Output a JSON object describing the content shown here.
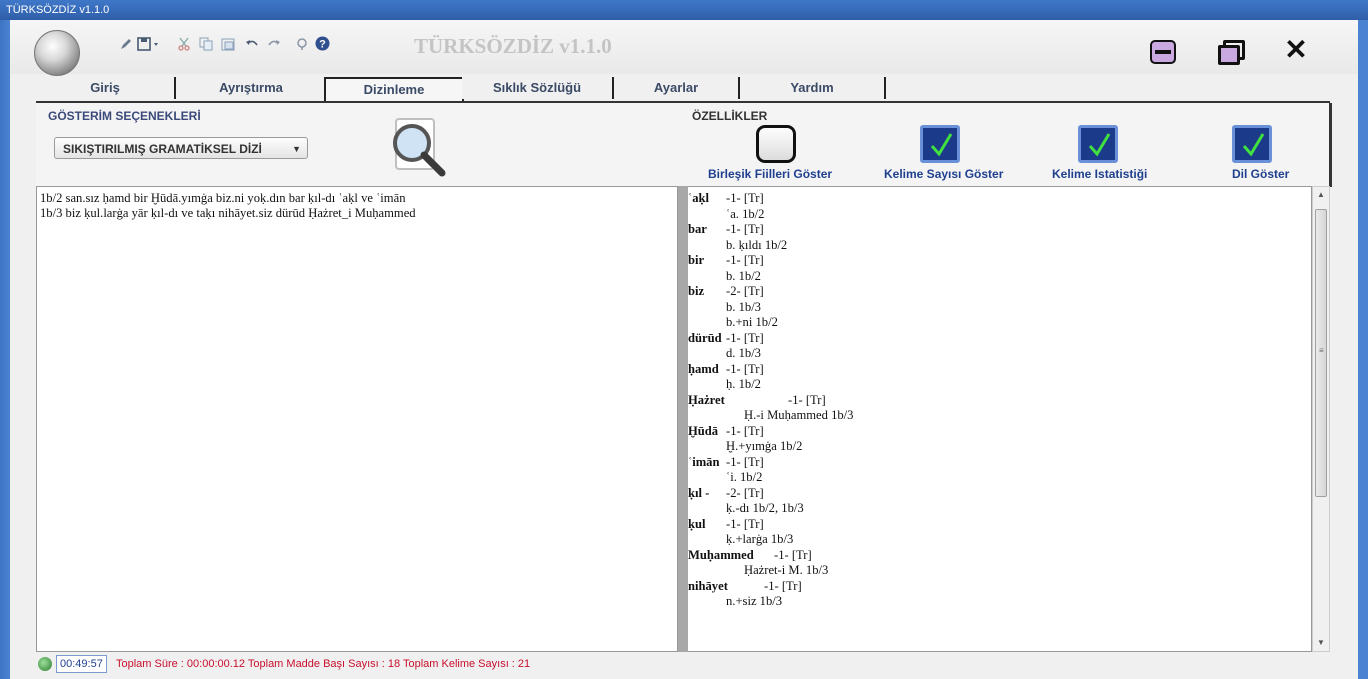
{
  "window": {
    "title": "TÜRKSÖZDİZ v1.1.0",
    "app_title": "TÜRKSÖZDİZ v1.1.0"
  },
  "toolbar_icons": [
    "edit-icon",
    "save-icon",
    "cut-icon",
    "copy-icon",
    "paste-icon",
    "undo-icon",
    "redo-icon",
    "pin-icon",
    "help-icon"
  ],
  "tabs": [
    {
      "label": "Giriş"
    },
    {
      "label": "Ayrıştırma"
    },
    {
      "label": "Dizinleme"
    },
    {
      "label": "Sıklık Sözlüğü"
    },
    {
      "label": "Ayarlar"
    },
    {
      "label": "Yardım"
    }
  ],
  "active_tab": "Dizinleme",
  "options": {
    "display_group_label": "GÖSTERİM SEÇENEKLERİ",
    "display_mode_value": "SIKIŞTIRILMIŞ GRAMATİKSEL DİZİ",
    "features_group_label": "ÖZELLİKLER",
    "checkboxes": [
      {
        "label": "Birleşik Fiilleri Göster",
        "checked": false
      },
      {
        "label": "Kelime Sayısı Göster",
        "checked": true
      },
      {
        "label": "Kelime Istatistiği",
        "checked": true
      },
      {
        "label": "Dil Göster",
        "checked": true
      }
    ]
  },
  "input_text": [
    "1b/2 san.sız ḥamd bir Ḫūdā.yımġa biz.ni yoḳ.dın bar ḳıl-dı ʿaḳl ve ʿimān",
    "1b/3 biz ḳul.larġa yār ḳıl-dı ve taḳı nihāyet.siz dürūd Ḥażret_i Muḥammed"
  ],
  "index_entries": [
    {
      "headword": "ʿaḳl",
      "count": "-1- [Tr]",
      "refs": [
        "ʿa. 1b/2"
      ]
    },
    {
      "headword": "bar",
      "count": "-1- [Tr]",
      "refs": [
        "b. ḳıldı 1b/2"
      ]
    },
    {
      "headword": "bir",
      "count": "-1- [Tr]",
      "refs": [
        "b. 1b/2"
      ]
    },
    {
      "headword": "biz",
      "count": "-2- [Tr]",
      "refs": [
        "b. 1b/3",
        "b.+ni 1b/2"
      ]
    },
    {
      "headword": "dürūd",
      "count": "-1- [Tr]",
      "refs": [
        "d. 1b/3"
      ]
    },
    {
      "headword": "ḥamd",
      "count": "-1- [Tr]",
      "refs": [
        "ḥ. 1b/2"
      ]
    },
    {
      "headword": "Ḥażret",
      "count": "-1- [Tr]",
      "refs": [
        "Ḥ.-i Muḥammed 1b/3"
      ]
    },
    {
      "headword": "Ḫūdā",
      "count": "-1- [Tr]",
      "refs": [
        "Ḫ.+yımġa 1b/2"
      ]
    },
    {
      "headword": "ʿimān",
      "count": "-1- [Tr]",
      "refs": [
        "ʿi. 1b/2"
      ]
    },
    {
      "headword": "ḳıl -",
      "count": "-2- [Tr]",
      "refs": [
        "ḳ.-dı 1b/2, 1b/3"
      ]
    },
    {
      "headword": "ḳul",
      "count": "-1- [Tr]",
      "refs": [
        "ḳ.+larġa 1b/3"
      ]
    },
    {
      "headword": "Muḥammed",
      "count": "-1- [Tr]",
      "refs": [
        "Ḥażret-i M. 1b/3"
      ]
    },
    {
      "headword": "nihāyet",
      "count": "-1- [Tr]",
      "refs": [
        "n.+siz 1b/3"
      ]
    }
  ],
  "status": {
    "clock": "00:49:57",
    "summary": "Toplam Süre : 00:00:00.12  Toplam Madde Başı Sayısı : 18  Toplam Kelime Sayısı : 21"
  },
  "colors": {
    "accent_blue": "#1f3f8f",
    "status_red": "#c8102e",
    "checkbox_fill": "#1b3a8a",
    "check_green": "#3fe03f"
  }
}
